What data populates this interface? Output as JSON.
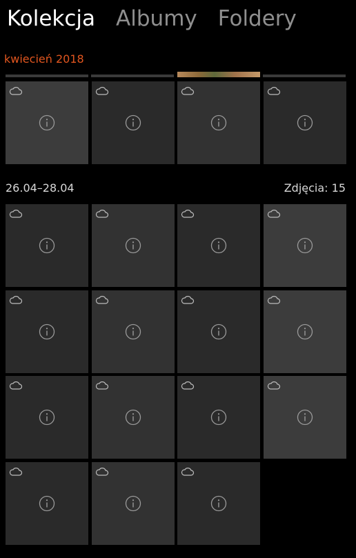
{
  "pivot": {
    "tabs": [
      {
        "label": "Kolekcja",
        "active": true
      },
      {
        "label": "Albumy",
        "active": false
      },
      {
        "label": "Foldery",
        "active": false
      }
    ]
  },
  "month_label": "kwiecień 2018",
  "accent_color": "#e2561f",
  "tile_icons": {
    "top_left": "cloud-icon",
    "center": "info-icon"
  },
  "top_group": {
    "tile_count": 4
  },
  "section": {
    "date_range": "26.04–28.04",
    "photo_count": "Zdjęcia: 15",
    "tile_count": 15
  }
}
